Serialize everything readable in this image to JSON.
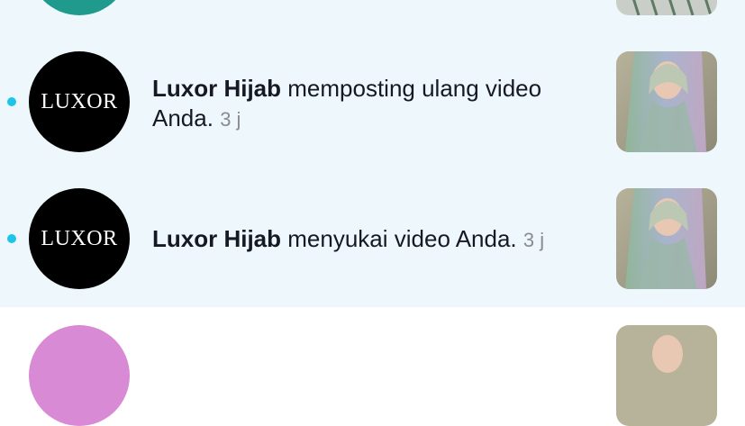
{
  "notifications": [
    {
      "unread": true,
      "avatar_label": "LUXOR",
      "user": "Luxor Hijab",
      "action": "memposting ulang video Anda.",
      "time": "3 j"
    },
    {
      "unread": true,
      "avatar_label": "LUXOR",
      "user": "Luxor Hijab",
      "action": "menyukai video Anda.",
      "time": "3 j"
    }
  ],
  "colors": {
    "unread_background": "#eef8fc",
    "unread_dot": "#20c4e8",
    "time_text": "#8a8b91"
  }
}
